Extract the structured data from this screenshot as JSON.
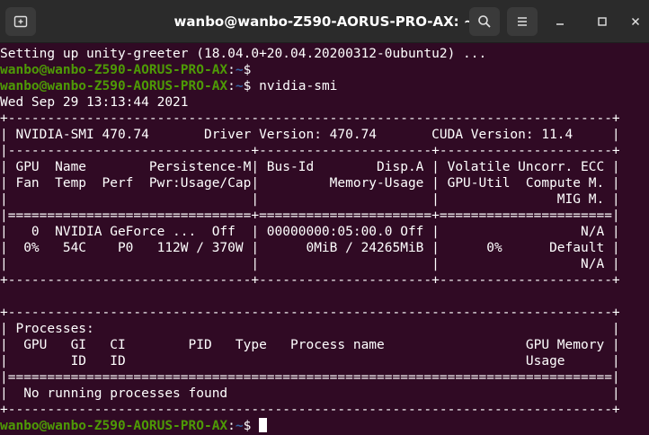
{
  "window": {
    "title": "wanbo@wanbo-Z590-AORUS-PRO-AX: ~"
  },
  "prompt": {
    "user_host": "wanbo@wanbo-Z590-AORUS-PRO-AX",
    "colon": ":",
    "path": "~",
    "symbol": "$ "
  },
  "terminal": {
    "line01": "Setting up unity-greeter (18.04.0+20.04.20200312-0ubuntu2) ...",
    "cmd2": "",
    "cmd3": "nvidia-smi",
    "line04": "Wed Sep 29 13:13:44 2021",
    "line05": "+-----------------------------------------------------------------------------+",
    "line06": "| NVIDIA-SMI 470.74       Driver Version: 470.74       CUDA Version: 11.4     |",
    "line07": "|-------------------------------+----------------------+----------------------+",
    "line08": "| GPU  Name        Persistence-M| Bus-Id        Disp.A | Volatile Uncorr. ECC |",
    "line09": "| Fan  Temp  Perf  Pwr:Usage/Cap|         Memory-Usage | GPU-Util  Compute M. |",
    "line10": "|                               |                      |               MIG M. |",
    "line11": "|===============================+======================+======================|",
    "line12": "|   0  NVIDIA GeForce ...  Off  | 00000000:05:00.0 Off |                  N/A |",
    "line13": "|  0%   54C    P0   112W / 370W |      0MiB / 24265MiB |      0%      Default |",
    "line14": "|                               |                      |                  N/A |",
    "line15": "+-------------------------------+----------------------+----------------------+",
    "line16": "",
    "line17": "+-----------------------------------------------------------------------------+",
    "line18": "| Processes:                                                                  |",
    "line19": "|  GPU   GI   CI        PID   Type   Process name                  GPU Memory |",
    "line20": "|        ID   ID                                                   Usage      |",
    "line21": "|=============================================================================|",
    "line22": "|  No running processes found                                                 |",
    "line23": "+-----------------------------------------------------------------------------+"
  },
  "colors": {
    "background": "#300a24",
    "prompt_user": "#4e9a06",
    "prompt_path": "#3465a4",
    "text": "#ffffff",
    "titlebar": "#2b2b2b"
  },
  "icons": {
    "new_tab": "new-tab-icon",
    "search": "search-icon",
    "menu": "hamburger-menu-icon",
    "minimize": "minimize-icon",
    "maximize": "maximize-icon",
    "close": "close-icon"
  }
}
